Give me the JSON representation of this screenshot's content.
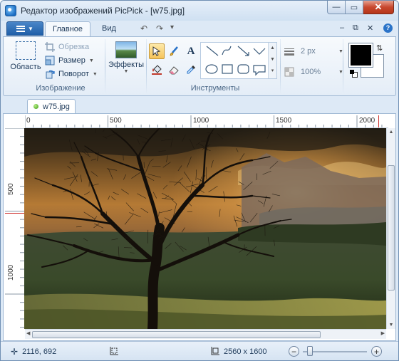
{
  "window": {
    "title": "Редактор изображений PicPick - [w75.jpg]",
    "controls": {
      "minimize": "—",
      "maximize": "▭",
      "close": "✕"
    }
  },
  "ribbon_tabs": {
    "file_menu": "☰",
    "tabs": [
      {
        "label": "Главное",
        "active": true
      },
      {
        "label": "Вид",
        "active": false
      }
    ],
    "quick_access": {
      "undo": "↶",
      "redo": "↷",
      "more": "▾"
    },
    "right_controls": {
      "minimize": "–",
      "restore": "⧉",
      "close": "✕",
      "help": "?"
    }
  },
  "ribbon": {
    "image_group": {
      "label": "Изображение",
      "select_button": "Область",
      "crop": "Обрезка",
      "resize": "Размер",
      "rotate": "Поворот"
    },
    "effects_group": {
      "label": "Эффекты"
    },
    "tools_group": {
      "label": "Инструменты",
      "tools": [
        "select-arrow",
        "brush",
        "text",
        "fill",
        "eraser",
        "color-picker"
      ]
    },
    "stroke": {
      "width": "2 px",
      "opacity": "100%"
    },
    "colors": {
      "primary": "#000000",
      "secondary": "#ffffff"
    }
  },
  "document": {
    "tab_label": "w75.jpg"
  },
  "rulers": {
    "horizontal_labels": [
      "0",
      "500",
      "1000",
      "1500",
      "2000"
    ],
    "vertical_labels": [
      "500",
      "1000"
    ]
  },
  "statusbar": {
    "cursor_position": "2116, 692",
    "image_size": "2560 x 1600",
    "zoom_minus": "−",
    "zoom_plus": "+"
  }
}
